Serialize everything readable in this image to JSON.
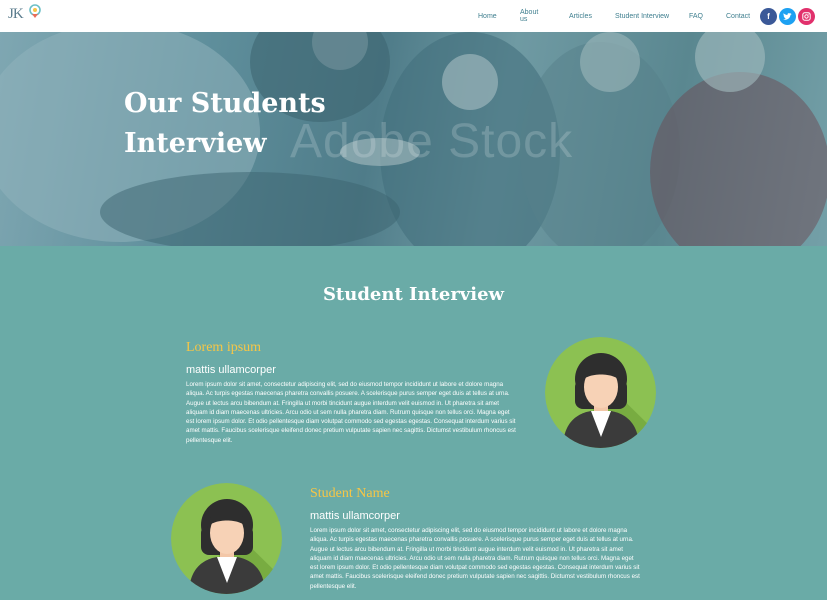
{
  "header": {
    "logo_text": "JK",
    "nav": {
      "home": "Home",
      "about": "About us",
      "articles": "Articles",
      "interview": "Student Interview",
      "faq": "FAQ",
      "contact": "Contact"
    },
    "social_icons": [
      "facebook-icon",
      "twitter-icon",
      "instagram-icon"
    ]
  },
  "hero": {
    "title_line1": "Our Students",
    "title_line2": "Interview",
    "watermark": "Adobe Stock"
  },
  "section": {
    "title": "Student Interview",
    "cards": [
      {
        "heading": "Lorem ipsum",
        "subheading": "mattis ullamcorper",
        "body": "Lorem ipsum dolor sit amet, consectetur adipiscing elit, sed do eiusmod tempor incididunt ut labore et dolore magna aliqua. Ac turpis egestas maecenas pharetra convallis posuere. A scelerisque purus semper eget duis at tellus at urna. Augue ut lectus arcu bibendum at. Fringilla ut morbi tincidunt augue interdum velit euismod in. Ut pharetra sit amet aliquam id diam maecenas ultricies. Arcu odio ut sem nulla pharetra diam. Rutrum quisque non tellus orci. Magna eget est lorem ipsum dolor. Et odio pellentesque diam volutpat commodo sed egestas egestas. Consequat interdum varius sit amet mattis. Faucibus scelerisque eleifend donec pretium vulputate sapien nec sagittis. Dictumst vestibulum rhoncus est pellentesque elit."
      },
      {
        "heading": "Student Name",
        "subheading": "mattis ullamcorper",
        "body": "Lorem ipsum dolor sit amet, consectetur adipiscing elit, sed do eiusmod tempor incididunt ut labore et dolore magna aliqua. Ac turpis egestas maecenas pharetra convallis posuere. A scelerisque purus semper eget duis at tellus at urna. Augue ut lectus arcu bibendum at. Fringilla ut morbi tincidunt augue interdum velit euismod in. Ut pharetra sit amet aliquam id diam maecenas ultricies. Arcu odio ut sem nulla pharetra diam. Rutrum quisque non tellus orci. Magna eget est lorem ipsum dolor. Et odio pellentesque diam volutpat commodo sed egestas egestas. Consequat interdum varius sit amet mattis. Faucibus scelerisque eleifend donec pretium vulputate sapien nec sagittis. Dictumst vestibulum rhoncus est pellentesque elit."
      }
    ]
  },
  "colors": {
    "teal_background": "#6aaba7",
    "accent_yellow": "#f6c646",
    "nav_text": "#3f7f8f",
    "avatar_green": "#8cc152"
  }
}
